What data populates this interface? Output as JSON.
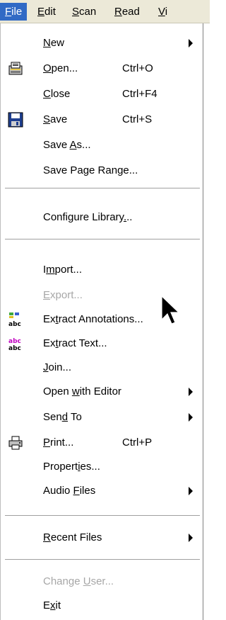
{
  "menubar": {
    "items": [
      {
        "label": "File",
        "mnemonic_index": 0
      },
      {
        "label": "Edit",
        "mnemonic_index": 0
      },
      {
        "label": "Scan",
        "mnemonic_index": 0
      },
      {
        "label": "Read",
        "mnemonic_index": 0
      },
      {
        "label": "Vi",
        "mnemonic_index": 0
      }
    ]
  },
  "file_menu": {
    "items": [
      {
        "label": "New",
        "mnemonic": 0,
        "submenu": true
      },
      {
        "label": "Open...",
        "mnemonic": 0,
        "shortcut": "Ctrl+O",
        "icon": "open-icon"
      },
      {
        "label": "Close",
        "mnemonic": 0,
        "shortcut": "Ctrl+F4"
      },
      {
        "label": "Save",
        "mnemonic": 0,
        "shortcut": "Ctrl+S",
        "icon": "save-icon"
      },
      {
        "label": "Save As...",
        "mnemonic": 5
      },
      {
        "label": "Save Page Range..."
      },
      {
        "label": "Configure Library...",
        "mnemonic": 17
      },
      {
        "label": "Import...",
        "mnemonic": 1
      },
      {
        "label": "Export...",
        "mnemonic": 0,
        "disabled": true
      },
      {
        "label": "Extract Annotations...",
        "mnemonic": 2,
        "icon": "extract-annotations-icon"
      },
      {
        "label": "Extract Text...",
        "mnemonic": 2,
        "icon": "extract-text-icon"
      },
      {
        "label": "Join...",
        "mnemonic": 0
      },
      {
        "label": "Open with Editor",
        "mnemonic": 5,
        "submenu": true
      },
      {
        "label": "Send To",
        "mnemonic": 3,
        "submenu": true
      },
      {
        "label": "Print...",
        "mnemonic": 0,
        "shortcut": "Ctrl+P",
        "icon": "print-icon"
      },
      {
        "label": "Properties...",
        "mnemonic": 7
      },
      {
        "label": "Audio Files",
        "mnemonic": 6,
        "submenu": true
      },
      {
        "label": "Recent Files",
        "mnemonic": 0,
        "submenu": true
      },
      {
        "label": "Change User...",
        "mnemonic": 7,
        "disabled": true
      },
      {
        "label": "Exit",
        "mnemonic": 1
      }
    ]
  },
  "colors": {
    "menubar_bg": "#ece9d8",
    "highlight": "#316ac5",
    "disabled_text": "#a7a7a7"
  }
}
